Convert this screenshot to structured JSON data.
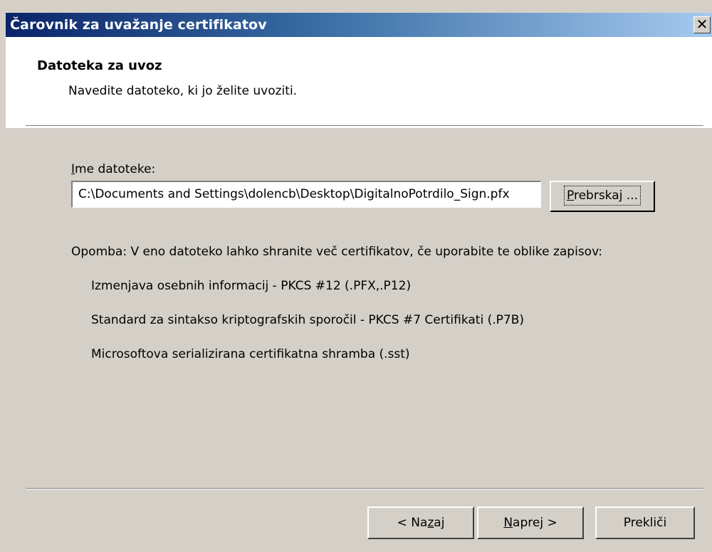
{
  "window": {
    "title": "Čarovnik za uvažanje certifikatov",
    "close_glyph": "✕"
  },
  "header": {
    "title": "Datoteka za uvoz",
    "subtitle": "Navedite datoteko, ki jo želite uvoziti."
  },
  "file": {
    "label_accel": "I",
    "label_rest": "me datoteke:",
    "value": "C:\\Documents and Settings\\dolencb\\Desktop\\DigitalnoPotrdilo_Sign.pfx",
    "browse_accel": "P",
    "browse_rest": "rebrskaj ..."
  },
  "note": {
    "text": "Opomba: V eno datoteko lahko shranite več certifikatov, če uporabite te oblike zapisov:",
    "formats": [
      "Izmenjava osebnih informacij - PKCS #12 (.PFX,.P12)",
      "Standard za sintakso kriptografskih sporočil - PKCS #7 Certifikati (.P7B)",
      "Microsoftova serializirana certifikatna shramba (.sst)"
    ]
  },
  "buttons": {
    "back_a": "< Na",
    "back_accel": "z",
    "back_b": "aj",
    "next_accel": "N",
    "next_rest": "aprej >",
    "cancel": "Prekliči"
  }
}
